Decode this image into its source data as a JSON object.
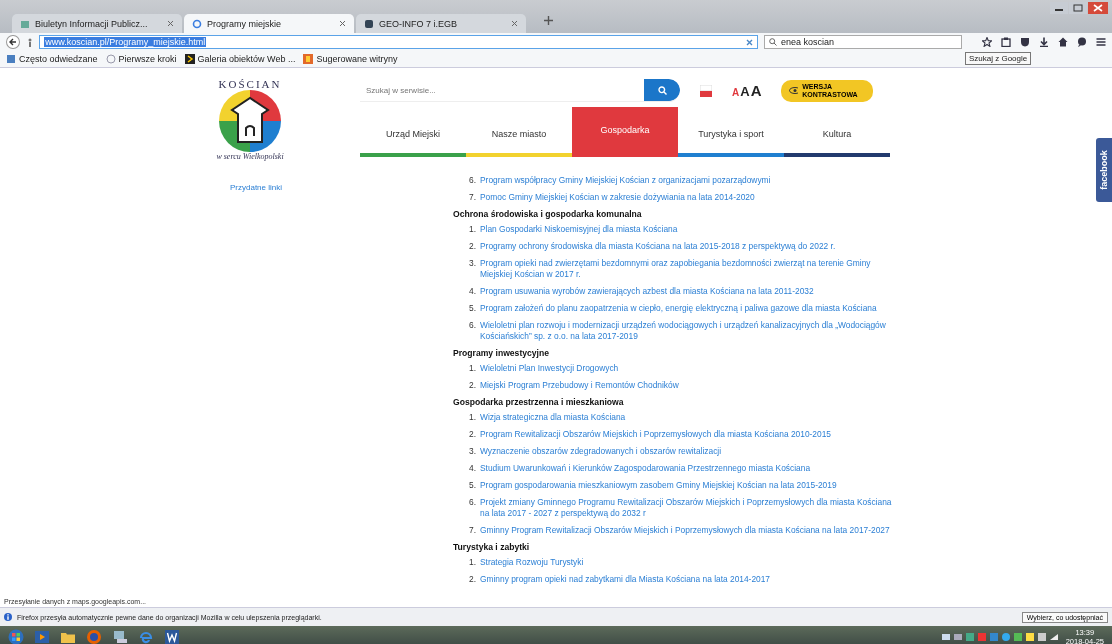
{
  "browser": {
    "tabs": [
      {
        "label": "Biuletyn Informacji Publicz...",
        "selected": false
      },
      {
        "label": "Programy miejskie",
        "selected": true
      },
      {
        "label": "GEO-INFO 7 i.EGB",
        "selected": false
      }
    ],
    "address": "www.koscian.pl/Programy_miejskie.html",
    "search_value": "enea koscian",
    "tooltip": "Szukaj z Google",
    "bookmarks": [
      "Często odwiedzane",
      "Pierwsze kroki",
      "Galeria obiektów Web ...",
      "Sugerowane witryny"
    ]
  },
  "site": {
    "logo_top": "KOŚCIAN",
    "logo_bottom": "w sercu Wielkopolski",
    "search_placeholder": "Szukaj w serwisie...",
    "font_sizes": [
      "A",
      "A",
      "A"
    ],
    "contrast": "WERSJA KONTRASTOWA",
    "menu": [
      {
        "label": "Urząd Miejski",
        "color": "#3aa14a",
        "selected": false
      },
      {
        "label": "Nasze miasto",
        "color": "#f2d22e",
        "selected": false
      },
      {
        "label": "Gospodarka",
        "color": "#e0393e",
        "selected": true
      },
      {
        "label": "Turystyka i sport",
        "color": "#1f7fd0",
        "selected": false
      },
      {
        "label": "Kultura",
        "color": "#223a6e",
        "selected": false
      }
    ],
    "sidebar_links": [
      "Przydatne linki"
    ],
    "sections": [
      {
        "items": [
          {
            "number": "6.",
            "text": "Program współpracy Gminy Miejskiej Kościan z organizacjami pozarządowymi"
          },
          {
            "number": "7.",
            "text": "Pomoc Gminy Miejskiej Kościan w zakresie dożywiania na lata 2014-2020"
          }
        ]
      },
      {
        "heading": "Ochrona środowiska i gospodarka komunalna",
        "items": [
          {
            "number": "1.",
            "text": "Plan Gospodarki Niskoemisyjnej dla miasta Kościana"
          },
          {
            "number": "2.",
            "text": "Programy ochrony środowiska dla miasta Kościana na lata 2015-2018 z perspektywą do 2022 r."
          },
          {
            "number": "3.",
            "text": "Program opieki nad zwierzętami bezdomnymi oraz zapobiegania bezdomności zwierząt na terenie Gminy Miejskiej Kościan w 2017 r."
          },
          {
            "number": "4.",
            "text": "Program usuwania wyrobów zawierających azbest dla miasta Kościana na lata 2011-2032"
          },
          {
            "number": "5.",
            "text": "Program założeń do planu zaopatrzenia w ciepło, energię elektryczną i paliwa gazowe dla miasta Kościana"
          },
          {
            "number": "6.",
            "text": "Wieloletni plan rozwoju i modernizacji urządzeń wodociągowych i urządzeń kanalizacyjnych dla „Wodociągów Kościańskich” sp. z o.o. na lata 2017-2019"
          }
        ]
      },
      {
        "heading": "Programy inwestycyjne",
        "items": [
          {
            "number": "1.",
            "text": "Wieloletni Plan Inwestycji Drogowych"
          },
          {
            "number": "2.",
            "text": "Miejski Program Przebudowy i Remontów Chodników"
          }
        ]
      },
      {
        "heading": "Gospodarka przestrzenna i mieszkaniowa",
        "items": [
          {
            "number": "1.",
            "text": "Wizja strategiczna dla miasta Kościana"
          },
          {
            "number": "2.",
            "text": "Program Rewitalizacji Obszarów Miejskich i Poprzemysłowych dla miasta Kościana 2010-2015"
          },
          {
            "number": "3.",
            "text": "Wyznaczenie obszarów zdegradowanych i obszarów rewitalizacji"
          },
          {
            "number": "4.",
            "text": "Studium Uwarunkowań i Kierunków Zagospodarowania Przestrzennego miasta Kościana"
          },
          {
            "number": "5.",
            "text": "Program gospodarowania mieszkaniowym zasobem Gminy Miejskiej Kościan na lata 2015-2019"
          },
          {
            "number": "6.",
            "text": "Projekt zmiany Gminnego Programu Rewitalizacji Obszarów Miejskich i Poprzemysłowych dla miasta Kościana na lata 2017 - 2027 z perspektywą do 2032 r"
          },
          {
            "number": "7.",
            "text": "Gminny Program Rewitalizacji Obszarów Miejskich i Poprzemysłowych dla miasta Kościana na lata 2017-2027"
          }
        ]
      },
      {
        "heading": "Turystyka i zabytki",
        "items": [
          {
            "number": "1.",
            "text": "Strategia Rozwoju Turystyki"
          },
          {
            "number": "2.",
            "text": "Gminny program opieki nad zabytkami dla Miasta Kościana na lata 2014-2017"
          }
        ]
      }
    ],
    "side_tab": "facebook"
  },
  "status": "Przesyłanie danych z maps.googleapis.com...",
  "notification": {
    "text": "Firefox przesyła automatycznie pewne dane do organizacji Mozilla w celu ulepszenia przeglądarki.",
    "button": "Wybierz, co udostępniać"
  },
  "taskbar": {
    "time": "13:39",
    "date": "2018-04-25"
  }
}
